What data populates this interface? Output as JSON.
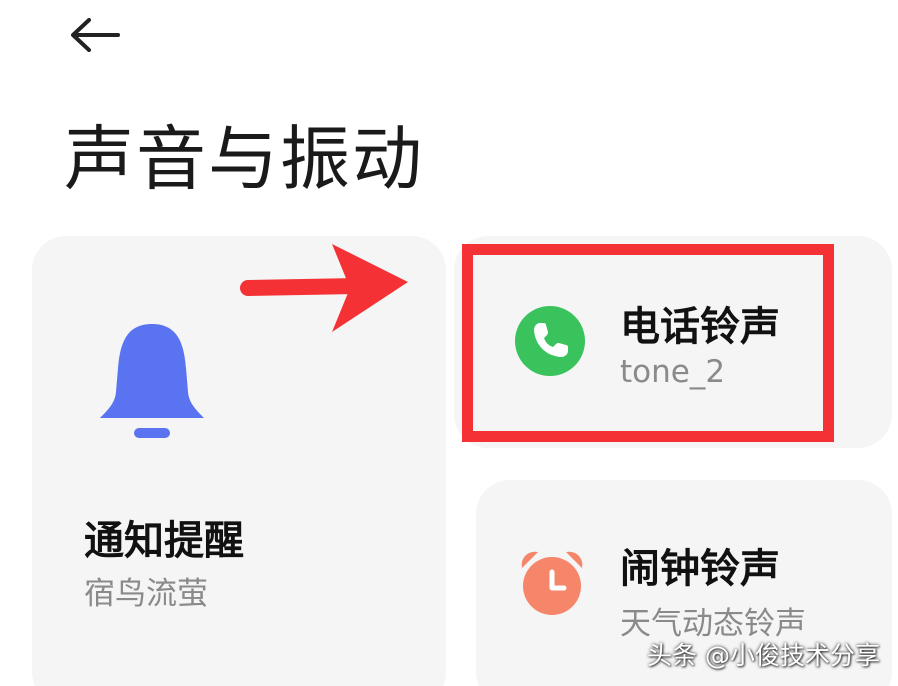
{
  "header": {
    "back_icon": "arrow-left-icon",
    "title": "声音与振动"
  },
  "cards": {
    "notification": {
      "icon": "bell-icon",
      "title": "通知提醒",
      "subtitle": "宿鸟流萤",
      "icon_color": "#5a73f0"
    },
    "ringtone": {
      "icon": "phone-icon",
      "title": "电话铃声",
      "subtitle": "tone_2",
      "icon_color": "#3ac35c"
    },
    "alarm": {
      "icon": "alarm-clock-icon",
      "title": "闹钟铃声",
      "subtitle": "天气动态铃声",
      "icon_color": "#f5866a"
    }
  },
  "annotation": {
    "color": "#f43235",
    "arrow_icon": "red-arrow-right-icon"
  },
  "watermark": {
    "text": "头条 @小俊技术分享"
  }
}
